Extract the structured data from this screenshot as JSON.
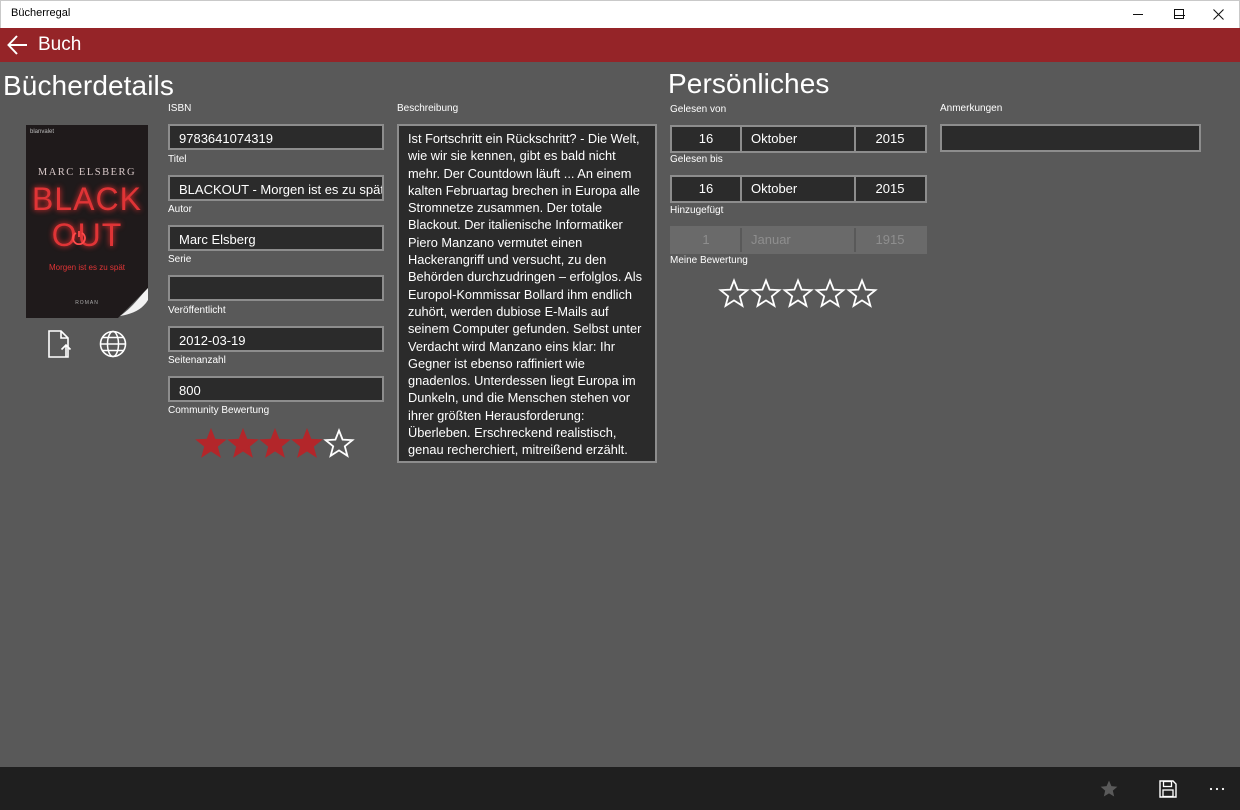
{
  "window": {
    "title": "Bücherregal"
  },
  "appbar": {
    "title": "Buch"
  },
  "details": {
    "heading": "Bücherdetails",
    "cover": {
      "publisher": "blanvalet",
      "author": "MARC ELSBERG",
      "title_line1": "BLACK",
      "title_line2": "OUT",
      "subtitle": "Morgen ist es zu spät",
      "genre": "ROMAN"
    },
    "fields": {
      "isbn": {
        "label": "ISBN",
        "value": "9783641074319"
      },
      "titel": {
        "label": "Titel",
        "value": "BLACKOUT - Morgen ist es zu spät"
      },
      "autor": {
        "label": "Autor",
        "value": "Marc Elsberg"
      },
      "serie": {
        "label": "Serie",
        "value": ""
      },
      "veroeffentlicht": {
        "label": "Veröffentlicht",
        "value": "2012-03-19"
      },
      "seitenanzahl": {
        "label": "Seitenanzahl",
        "value": "800"
      }
    },
    "community_rating": {
      "label": "Community Bewertung",
      "value": 4,
      "max": 5
    },
    "beschreibung": {
      "label": "Beschreibung",
      "text": "Ist Fortschritt ein Rückschritt? - Die Welt, wie wir sie kennen, gibt es bald nicht mehr. Der Countdown läuft ... An einem kalten Februartag brechen in Europa alle Stromnetze zusammen. Der totale Blackout. Der italienische Informatiker Piero Manzano vermutet einen Hackerangriff und versucht, zu den Behörden durchzudringen – erfolglos. Als Europol-Kommissar Bollard ihm endlich zuhört, werden dubiose E-Mails auf seinem Computer gefunden. Selbst unter Verdacht wird Manzano eins klar: Ihr Gegner ist ebenso raffiniert wie gnadenlos. Unterdessen liegt Europa im Dunkeln, und die Menschen stehen vor ihrer größten Herausforderung: Überleben. Erschreckend realistisch, genau recherchiert, mitreißend erzählt."
    }
  },
  "personal": {
    "heading": "Persönliches",
    "gelesen_von": {
      "label": "Gelesen von",
      "day": "16",
      "month": "Oktober",
      "year": "2015"
    },
    "gelesen_bis": {
      "label": "Gelesen bis",
      "day": "16",
      "month": "Oktober",
      "year": "2015"
    },
    "hinzugefuegt": {
      "label": "Hinzugefügt",
      "day": "1",
      "month": "Januar",
      "year": "1915"
    },
    "meine_bewertung": {
      "label": "Meine Bewertung",
      "value": 0,
      "max": 5
    },
    "anmerkungen": {
      "label": "Anmerkungen",
      "value": ""
    }
  },
  "icons": {
    "back": "arrow-left-icon",
    "open_file": "file-upload-icon",
    "web": "globe-icon",
    "favorite": "star-icon",
    "save": "save-icon",
    "more": "ellipsis-icon"
  },
  "colors": {
    "accent": "#952428",
    "star_filled": "#b3262a",
    "background": "#595959"
  }
}
